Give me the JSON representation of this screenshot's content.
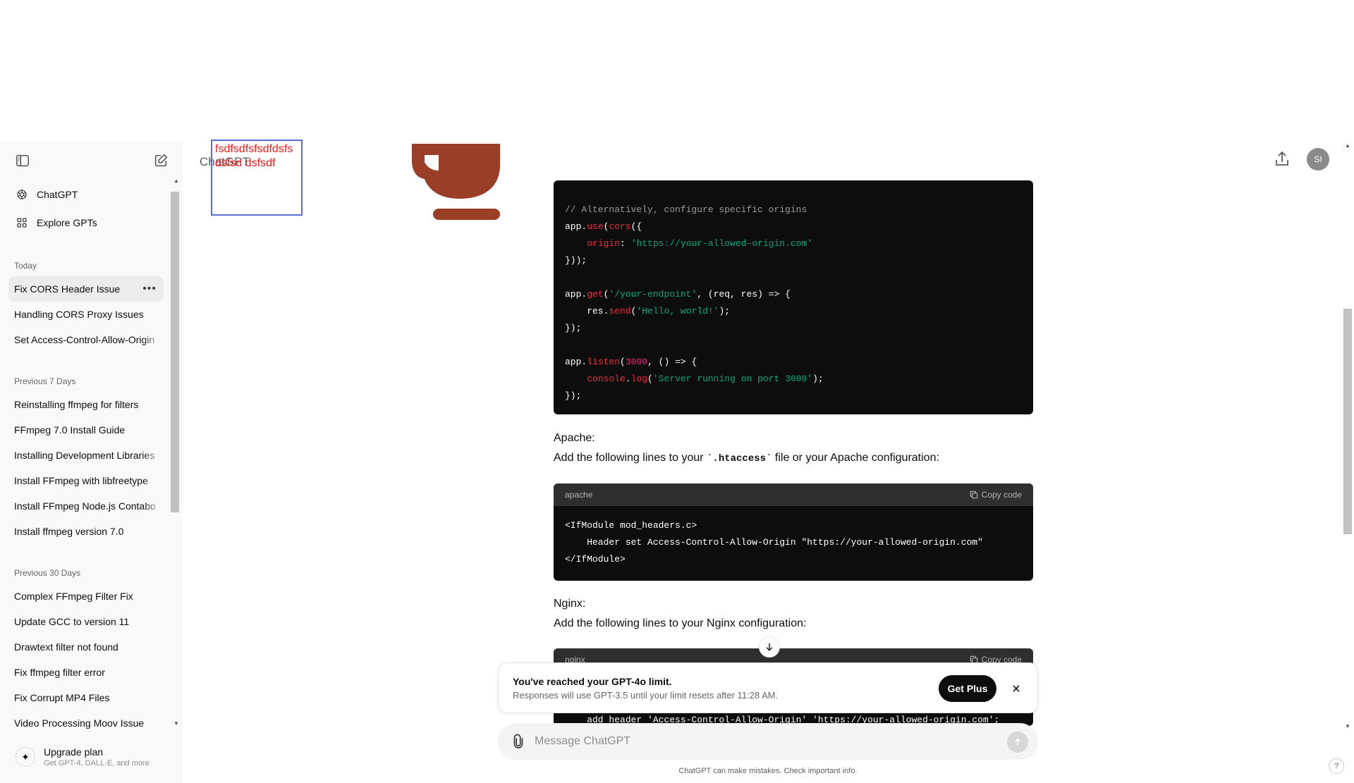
{
  "sidebar": {
    "nav": [
      {
        "label": "ChatGPT",
        "icon": "openai-logo-icon"
      },
      {
        "label": "Explore GPTs",
        "icon": "grid-icon"
      }
    ],
    "sections": [
      {
        "title": "Today",
        "items": [
          "Fix CORS Header Issue",
          "Handling CORS Proxy Issues",
          "Set Access-Control-Allow-Origin"
        ]
      },
      {
        "title": "Previous 7 Days",
        "items": [
          "Reinstalling ffmpeg for filters",
          "FFmpeg 7.0 Install Guide",
          "Installing Development Libraries",
          "Install FFmpeg with libfreetype",
          "Install FFmpeg Node.js Contabo",
          "Install ffmpeg version 7.0"
        ]
      },
      {
        "title": "Previous 30 Days",
        "items": [
          "Complex FFmpeg Filter Fix",
          "Update GCC to version 11",
          "Drawtext filter not found",
          "Fix ffmpeg filter error",
          "Fix Corrupt MP4 Files",
          "Video Processing Moov Issue"
        ]
      }
    ],
    "active_chat": "Fix CORS Header Issue",
    "upgrade": {
      "title": "Upgrade plan",
      "subtitle": "Get GPT-4, DALL·E, and more"
    }
  },
  "header": {
    "model_title": "ChatGPT",
    "overlay_text": "fsdfsdfsfsdfdsfs dsfsd dsfsdf",
    "avatar_initials": "SI"
  },
  "content": {
    "code1_lines": [
      "// Alternatively, configure specific origins",
      "app.use(cors({",
      "    origin: 'https://your-allowed-origin.com'",
      "}));",
      "",
      "app.get('/your-endpoint', (req, res) => {",
      "    res.send('Hello, world!');",
      "});",
      "",
      "app.listen(3000, () => {",
      "    console.log('Server running on port 3000');",
      "});"
    ],
    "apache_heading": "Apache:",
    "apache_text_before": "Add the following lines to your ",
    "apache_inline_code": "`.htaccess`",
    "apache_text_after": " file or your Apache configuration:",
    "apache_lang": "apache",
    "copy_label": "Copy code",
    "apache_code": "<IfModule mod_headers.c>\n    Header set Access-Control-Allow-Origin \"https://your-allowed-origin.com\"\n</IfModule>",
    "nginx_heading": "Nginx:",
    "nginx_text": "Add the following lines to your Nginx configuration:",
    "nginx_lang": "nginx",
    "nginx_partial": "    add_header 'Access-Control-Allow-Origin' 'https://your-allowed-origin.com';"
  },
  "limit_banner": {
    "title": "You've reached your GPT-4o limit.",
    "subtitle": "Responses will use GPT-3.5 until your limit resets after 11:28 AM.",
    "button": "Get Plus"
  },
  "composer": {
    "placeholder": "Message ChatGPT",
    "disclaimer": "ChatGPT can make mistakes. Check important info.",
    "help": "?"
  }
}
